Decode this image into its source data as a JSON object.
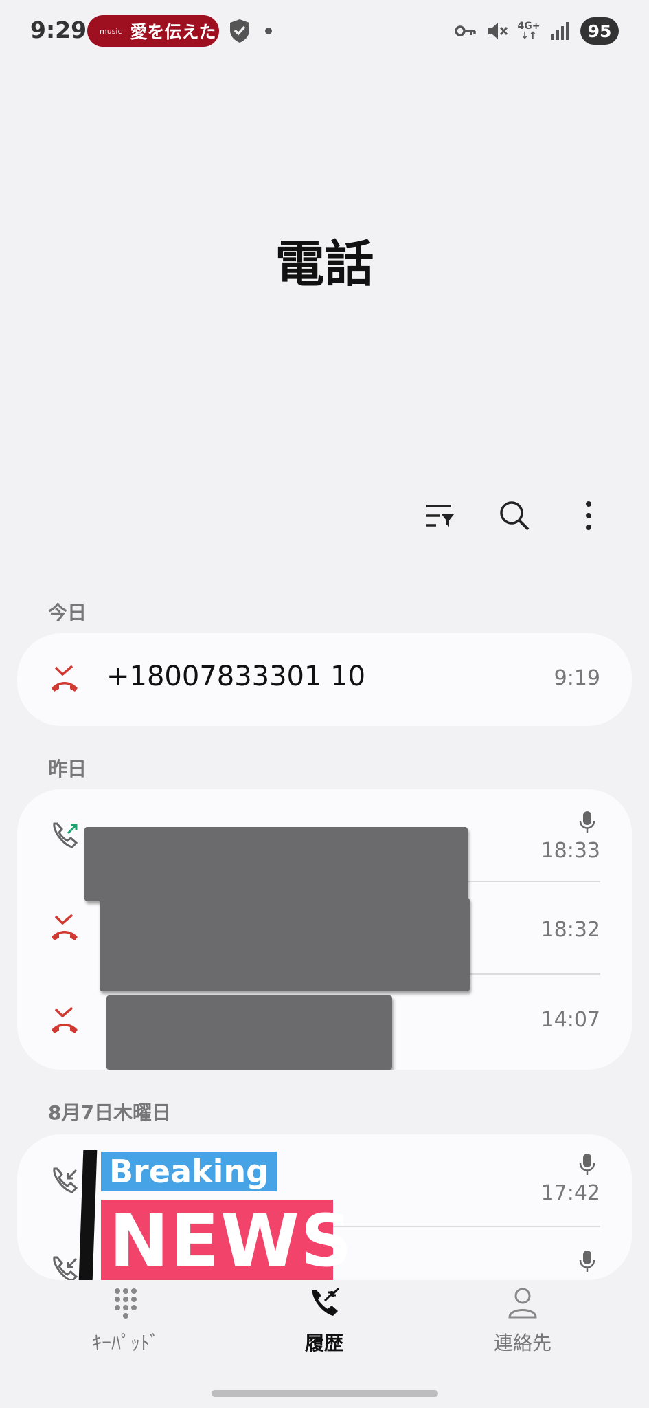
{
  "status_bar": {
    "time": "9:29",
    "music_brand": "music",
    "music_title": "愛を伝えた",
    "network": "4G+",
    "battery": "95"
  },
  "title": "電話",
  "toolbar": {
    "icons": [
      "filter-icon",
      "search-icon",
      "more-vertical-icon"
    ]
  },
  "sections": [
    {
      "label": "今日",
      "calls": [
        {
          "type": "missed",
          "name": "+18007833301 10",
          "time": "9:19"
        }
      ]
    },
    {
      "label": "昨日",
      "calls": [
        {
          "type": "outgoing",
          "name": "",
          "time": "18:33",
          "recorded": true
        },
        {
          "type": "missed",
          "name": "",
          "time": "18:32"
        },
        {
          "type": "missed",
          "name": "",
          "time": "14:07"
        }
      ]
    },
    {
      "label": "8月7日木曜日",
      "calls": [
        {
          "type": "incoming",
          "name": "",
          "time": "17:42",
          "recorded": true
        },
        {
          "type": "incoming",
          "name": "",
          "time": "",
          "recorded": true
        }
      ]
    }
  ],
  "overlay": {
    "breaking": "Breaking",
    "news": "NEWS"
  },
  "bottom_nav": [
    {
      "label": "ｷｰﾊﾟｯﾄﾞ",
      "icon": "keypad-icon"
    },
    {
      "label": "履歴",
      "icon": "call-history-icon",
      "active": true
    },
    {
      "label": "連絡先",
      "icon": "contacts-icon"
    }
  ],
  "colors": {
    "missed": "#d13a33",
    "outgoing_arrow": "#1aa36e",
    "music_pill": "#9e1020",
    "news_blue": "#46a4e6",
    "news_pink": "#f2436a"
  }
}
